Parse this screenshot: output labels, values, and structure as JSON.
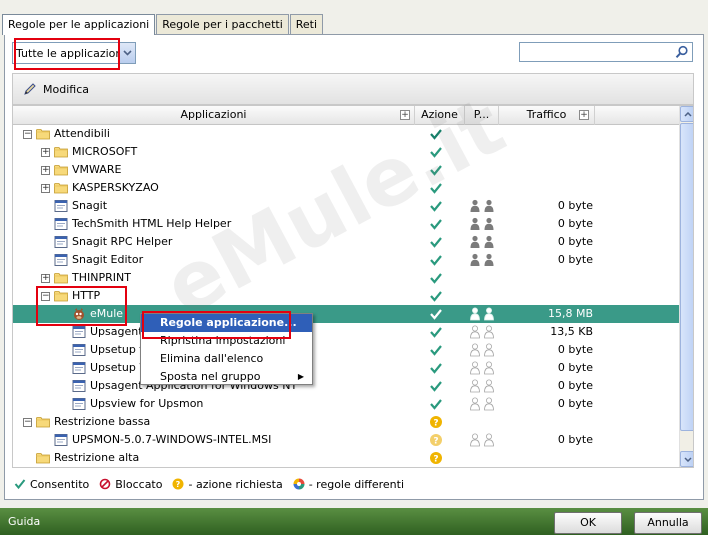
{
  "tabs": [
    {
      "label": "Regole per le applicazioni",
      "active": true
    },
    {
      "label": "Regole per i pacchetti",
      "active": false
    },
    {
      "label": "Reti",
      "active": false
    }
  ],
  "filter": {
    "selected": "Tutte le applicazioni"
  },
  "search": {
    "value": "",
    "placeholder": ""
  },
  "toolbar": {
    "edit_label": "Modifica"
  },
  "columns": {
    "applications": "Applicazioni",
    "action": "Azione",
    "p": "P...",
    "traffic": "Traffico"
  },
  "rows": [
    {
      "name": "Attendibili",
      "level": 0,
      "type": "folder",
      "expander": "−",
      "action": "allow-dark",
      "people": "",
      "traffic": ""
    },
    {
      "name": "MICROSOFT",
      "level": 1,
      "type": "folder",
      "expander": "+",
      "action": "allow",
      "people": "",
      "traffic": ""
    },
    {
      "name": "VMWARE",
      "level": 1,
      "type": "folder",
      "expander": "+",
      "action": "allow",
      "people": "",
      "traffic": ""
    },
    {
      "name": "KASPERSKYZAO",
      "level": 1,
      "type": "folder",
      "expander": "+",
      "action": "allow",
      "people": "",
      "traffic": ""
    },
    {
      "name": "Snagit",
      "level": 1,
      "type": "app",
      "expander": "",
      "action": "allow",
      "people": "dark",
      "traffic": "0 byte"
    },
    {
      "name": "TechSmith HTML Help Helper",
      "level": 1,
      "type": "app",
      "expander": "",
      "action": "allow",
      "people": "dark",
      "traffic": "0 byte"
    },
    {
      "name": "Snagit RPC Helper",
      "level": 1,
      "type": "app",
      "expander": "",
      "action": "allow",
      "people": "dark",
      "traffic": "0 byte"
    },
    {
      "name": "Snagit Editor",
      "level": 1,
      "type": "app",
      "expander": "",
      "action": "allow",
      "people": "dark",
      "traffic": "0 byte"
    },
    {
      "name": "THINPRINT",
      "level": 1,
      "type": "folder",
      "expander": "+",
      "action": "allow",
      "people": "",
      "traffic": ""
    },
    {
      "name": "HTTP",
      "level": 1,
      "type": "folder",
      "expander": "−",
      "action": "allow",
      "people": "",
      "traffic": ""
    },
    {
      "name": "eMule",
      "level": 2,
      "type": "emule",
      "expander": "",
      "action": "allow-white",
      "people": "white",
      "traffic": "15,8 MB",
      "selected": true
    },
    {
      "name": "Upsagent service",
      "level": 2,
      "type": "app",
      "expander": "",
      "action": "allow",
      "people": "light",
      "traffic": "13,5 KB"
    },
    {
      "name": "Upsetup for Windows NT",
      "level": 2,
      "type": "app",
      "expander": "",
      "action": "allow",
      "people": "light",
      "traffic": "0 byte"
    },
    {
      "name": "Upsetup Wizard",
      "level": 2,
      "type": "app",
      "expander": "",
      "action": "allow",
      "people": "light",
      "traffic": "0 byte"
    },
    {
      "name": "Upsagent Application for Windows NT",
      "level": 2,
      "type": "app",
      "expander": "",
      "action": "allow",
      "people": "light",
      "traffic": "0 byte"
    },
    {
      "name": "Upsview for Upsmon",
      "level": 2,
      "type": "app",
      "expander": "",
      "action": "allow",
      "people": "light",
      "traffic": "0 byte"
    },
    {
      "name": "Restrizione bassa",
      "level": 0,
      "type": "folder",
      "expander": "−",
      "action": "ask",
      "people": "",
      "traffic": ""
    },
    {
      "name": "UPSMON-5.0.7-WINDOWS-INTEL.MSI",
      "level": 1,
      "type": "app",
      "expander": "",
      "action": "ask-light",
      "people": "light",
      "traffic": "0 byte"
    },
    {
      "name": "Restrizione alta",
      "level": 0,
      "type": "folder",
      "expander": "",
      "action": "ask",
      "people": "",
      "traffic": ""
    }
  ],
  "context_menu": {
    "items": [
      {
        "label": "Regole applicazione...",
        "highlighted": true
      },
      {
        "label": "Ripristina impostazioni",
        "highlighted": false
      },
      {
        "label": "Elimina dall'elenco",
        "highlighted": false
      },
      {
        "label": "Sposta nel gruppo",
        "highlighted": false,
        "submenu": true
      }
    ]
  },
  "legend": {
    "allowed": "Consentito",
    "blocked": "Bloccato",
    "ask": "- azione richiesta",
    "different": "- regole differenti"
  },
  "footer": {
    "help": "Guida",
    "ok": "OK",
    "cancel": "Annulla"
  },
  "watermark": "eMule.it",
  "colors": {
    "accent_green": "#3d6e2c",
    "selection": "#3a9a88",
    "check": "#2a9a7e",
    "ask": "#f0b400",
    "highlight": "#e3000f",
    "menu_highlight": "#2f5fb8"
  }
}
